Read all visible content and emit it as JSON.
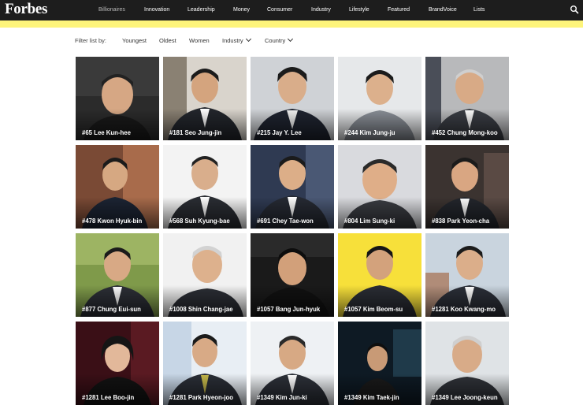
{
  "brand": {
    "logo": "Forbes"
  },
  "nav": {
    "items": [
      {
        "label": "Billionaires",
        "active": true
      },
      {
        "label": "Innovation",
        "active": false
      },
      {
        "label": "Leadership",
        "active": false
      },
      {
        "label": "Money",
        "active": false
      },
      {
        "label": "Consumer",
        "active": false
      },
      {
        "label": "Industry",
        "active": false
      },
      {
        "label": "Lifestyle",
        "active": false
      },
      {
        "label": "Featured",
        "active": false
      },
      {
        "label": "BrandVoice",
        "active": false
      },
      {
        "label": "Lists",
        "active": false
      }
    ],
    "search_icon": "search-icon"
  },
  "accent_colors": {
    "navbar": "#1d1d1d",
    "highlight_bar": "#fdf47b"
  },
  "filter": {
    "label": "Filter list by:",
    "options": [
      "Youngest",
      "Oldest",
      "Women",
      "Industry",
      "Country"
    ]
  },
  "people": [
    {
      "caption": "#65 Lee Kun-hee"
    },
    {
      "caption": "#181 Seo Jung-jin"
    },
    {
      "caption": "#215 Jay Y. Lee"
    },
    {
      "caption": "#244 Kim Jung-ju"
    },
    {
      "caption": "#452 Chung Mong-koo"
    },
    {
      "caption": "#478 Kwon Hyuk-bin"
    },
    {
      "caption": "#568 Suh Kyung-bae"
    },
    {
      "caption": "#691 Chey Tae-won"
    },
    {
      "caption": "#804 Lim Sung-ki"
    },
    {
      "caption": "#838 Park Yeon-cha"
    },
    {
      "caption": "#877 Chung Eui-sun"
    },
    {
      "caption": "#1008 Shin Chang-jae"
    },
    {
      "caption": "#1057 Bang Jun-hyuk"
    },
    {
      "caption": "#1057 Kim Beom-su"
    },
    {
      "caption": "#1281 Koo Kwang-mo"
    },
    {
      "caption": "#1281 Lee Boo-jin"
    },
    {
      "caption": "#1281 Park Hyeon-joo"
    },
    {
      "caption": "#1349 Kim Jun-ki"
    },
    {
      "caption": "#1349 Kim Taek-jin"
    },
    {
      "caption": "#1349 Lee Joong-keun"
    }
  ]
}
